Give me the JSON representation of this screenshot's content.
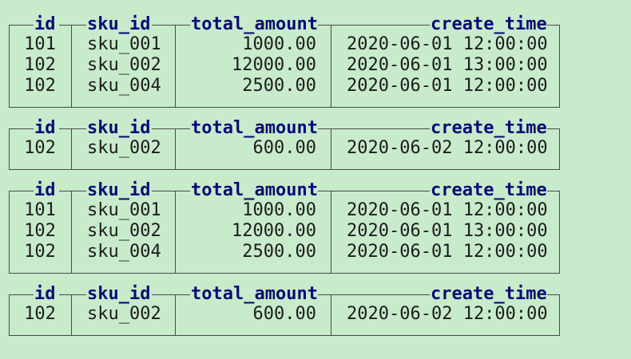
{
  "colors": {
    "background": "#c8ebcc",
    "header_text": "#0a0a7a",
    "cell_text": "#1c1c1c",
    "border": "#4a4a4a"
  },
  "columns": [
    "id",
    "sku_id",
    "total_amount",
    "create_time"
  ],
  "tables": [
    {
      "rows": [
        [
          "101",
          "sku_001",
          "1000.00",
          "2020-06-01 12:00:00"
        ],
        [
          "102",
          "sku_002",
          "12000.00",
          "2020-06-01 13:00:00"
        ],
        [
          "102",
          "sku_004",
          "2500.00",
          "2020-06-01 12:00:00"
        ]
      ]
    },
    {
      "rows": [
        [
          "102",
          "sku_002",
          "600.00",
          "2020-06-02 12:00:00"
        ]
      ]
    },
    {
      "rows": [
        [
          "101",
          "sku_001",
          "1000.00",
          "2020-06-01 12:00:00"
        ],
        [
          "102",
          "sku_002",
          "12000.00",
          "2020-06-01 13:00:00"
        ],
        [
          "102",
          "sku_004",
          "2500.00",
          "2020-06-01 12:00:00"
        ]
      ]
    },
    {
      "rows": [
        [
          "102",
          "sku_002",
          "600.00",
          "2020-06-02 12:00:00"
        ]
      ]
    }
  ]
}
